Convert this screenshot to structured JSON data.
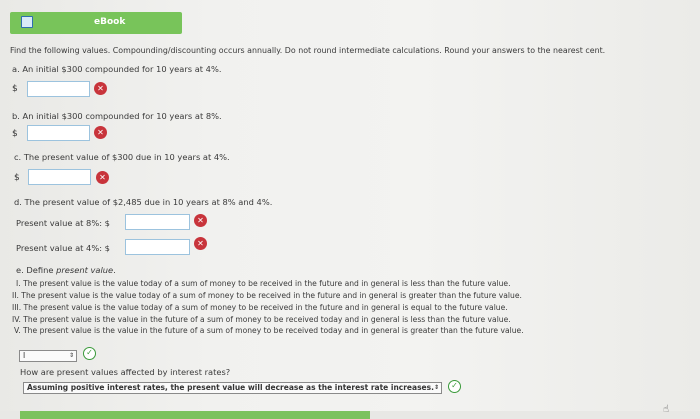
{
  "header": {
    "ebook_label": "eBook"
  },
  "instructions": "Find the following values. Compounding/discounting occurs annually. Do not round intermediate calculations. Round your answers to the nearest cent.",
  "part_a": {
    "question": "a. An initial $300 compounded for 10 years at 4%.",
    "currency": "$",
    "value": ""
  },
  "part_b": {
    "question": "b. An initial $300 compounded for 10 years at 8%.",
    "currency": "$",
    "value": ""
  },
  "part_c": {
    "question": "c. The present value of $300 due in 10 years at 4%.",
    "currency": "$",
    "value": ""
  },
  "part_d": {
    "question": "d. The present value of $2,485 due in 10 years at 8% and 4%.",
    "pv8_label": "Present value at 8%: $",
    "pv4_label": "Present value at 4%: $",
    "pv8_value": "",
    "pv4_value": ""
  },
  "part_e": {
    "question_prefix": "e. Define ",
    "question_term": "present value",
    "question_suffix": ".",
    "options": [
      "I.  The present value is the value today of a sum of money to be received in the future and in general is less than the future value.",
      "II.  The present value is the value today of a sum of money to be received in the future and in general is greater than the future value.",
      "III.  The present value is the value today of a sum of money to be received in the future and in general is equal to the future value.",
      "IV.  The present value is the value in the future of a sum of money to be received today and in general is less than the future value.",
      "V.  The present value is the value in the future of a sum of money to be received today and in general is greater than the future value."
    ],
    "selected": "I"
  },
  "rates_question": "How are present values affected by interest rates?",
  "rates_answer": "Assuming positive interest rates, the present value will decrease as the interest rate increases.",
  "icons": {
    "wrong": "x-circle-icon",
    "correct": "check-circle-icon"
  },
  "colors": {
    "ebook_green": "#78c45a",
    "wrong_red": "#c8343b",
    "correct_green": "#3a9a3a"
  }
}
